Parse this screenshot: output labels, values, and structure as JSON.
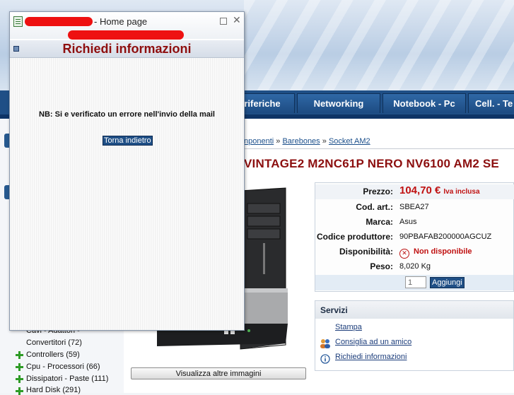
{
  "nav": {
    "tabs": [
      "riferiche",
      "Networking",
      "Notebook - Pc",
      "Cell. - Te"
    ]
  },
  "breadcrumb": {
    "items": [
      "nponenti",
      "Barebones",
      "Socket AM2"
    ],
    "separator": "»"
  },
  "product": {
    "title": "VINTAGE2 M2NC61P NERO NV6100 AM2 SE",
    "more_images_label": "Visualizza altre immagini",
    "fields": {
      "price_label": "Prezzo:",
      "price_value": "104,70 €",
      "price_note": "Iva inclusa",
      "code_label": "Cod. art.:",
      "code_value": "SBEA27",
      "brand_label": "Marca:",
      "brand_value": "Asus",
      "mfr_label": "Codice produttore:",
      "mfr_value": "90PBAFAB200000AGCUZ",
      "avail_label": "Disponibilità:",
      "avail_value": "Non disponibile",
      "weight_label": "Peso:",
      "weight_value": "8,020 Kg"
    },
    "quantity_value": "1",
    "add_label": "Aggiungi"
  },
  "services": {
    "title": "Servizi",
    "links": [
      "Stampa",
      "Consiglia ad un amico",
      "Richiedi informazioni"
    ]
  },
  "categories": [
    "Cavi - Adattori -",
    "Convertitori (72)",
    "Controllers (59)",
    "Cpu - Processori (66)",
    "Dissipatori - Paste (111)",
    "Hard Disk (291)"
  ],
  "popup": {
    "title": "- Home page",
    "heading": "Richiedi informazioni",
    "message": "NB: Si e verificato un errore nell'invio della mail",
    "back_label": "Torna indietro",
    "close_glyph": "✕"
  },
  "colors": {
    "nav_blue": "#1f4f86",
    "title_red": "#8c0f0f",
    "price_red": "#c01111",
    "redaction": "#ee1111"
  }
}
